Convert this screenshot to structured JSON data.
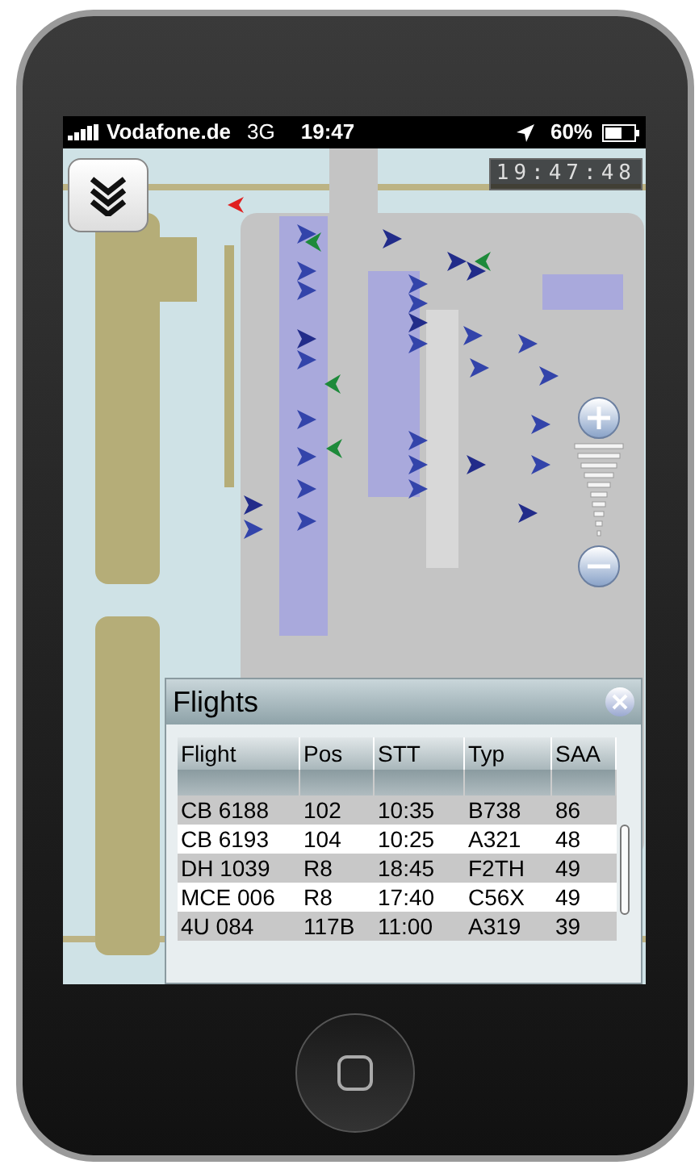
{
  "status_bar": {
    "carrier": "Vodafone.de",
    "network": "3G",
    "time": "19:47",
    "battery": "60%"
  },
  "clock": "19:47:48",
  "flights_panel": {
    "title": "Flights",
    "columns": [
      "Flight",
      "Pos",
      "STT",
      "Typ",
      "SAA"
    ],
    "rows": [
      [
        "CB 6188",
        "102",
        "10:35",
        "B738",
        "86"
      ],
      [
        "CB 6193",
        "104",
        "10:25",
        "A321",
        "48"
      ],
      [
        "DH 1039",
        "R8",
        "18:45",
        "F2TH",
        "49"
      ],
      [
        "MCE 006",
        "R8",
        "17:40",
        "C56X",
        "49"
      ],
      [
        "4U 084",
        "117B",
        "11:00",
        "A319",
        "39"
      ]
    ]
  }
}
